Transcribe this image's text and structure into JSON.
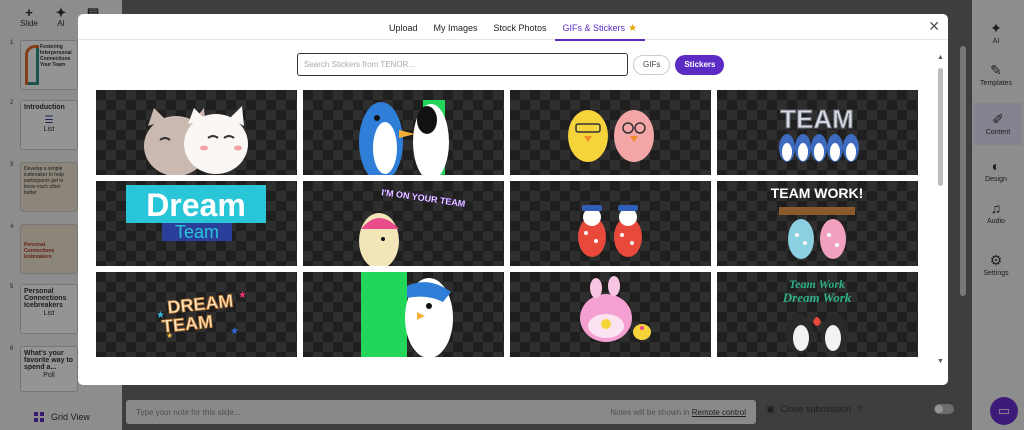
{
  "top_tools": [
    {
      "icon": "plus-icon",
      "label": "Slide"
    },
    {
      "icon": "sparkle-icon",
      "label": "AI"
    }
  ],
  "slides": [
    {
      "num": "1",
      "title": "Fostering Interpersonal Connections Your Team",
      "style": "stripes"
    },
    {
      "num": "2",
      "title": "Introduction",
      "sub": "List"
    },
    {
      "num": "3",
      "title": "Develop a simple icebreaker to help participants get to know each other better",
      "style": "tan"
    },
    {
      "num": "4",
      "title": "Personal Connections Icebreakers",
      "style": "tan"
    },
    {
      "num": "5",
      "title": "Personal Connections Icebreakers",
      "sub": "List"
    },
    {
      "num": "6",
      "title": "What's your favorite way to spend a...",
      "sub": "Poll"
    }
  ],
  "grid_view_label": "Grid View",
  "right_rail": [
    {
      "icon": "sparkle-icon",
      "label": "AI"
    },
    {
      "icon": "templates-icon",
      "label": "Templates"
    },
    {
      "icon": "pencil-icon",
      "label": "Content",
      "active": true
    },
    {
      "icon": "palette-icon",
      "label": "Design"
    },
    {
      "icon": "music-icon",
      "label": "Audio"
    },
    {
      "icon": "gear-icon",
      "label": "Settings"
    }
  ],
  "note_bar": {
    "placeholder": "Type your note for this slide...",
    "hint": "Notes will be shown in",
    "link": "Remote control"
  },
  "close_submission": "Close submission",
  "modal": {
    "tabs": [
      {
        "label": "Upload"
      },
      {
        "label": "My Images"
      },
      {
        "label": "Stock Photos"
      },
      {
        "label": "GIFs & Stickers",
        "active": true
      }
    ],
    "search_placeholder": "Search Stickers from TENOR...",
    "search_value": "",
    "filter_gifs": "GIFs",
    "filter_stickers": "Stickers",
    "stickers": [
      {
        "name": "hugging-cats-sticker",
        "text": ""
      },
      {
        "name": "penguins-high-five-sticker",
        "text": ""
      },
      {
        "name": "chicks-sticker",
        "text": ""
      },
      {
        "name": "team-penguins-sticker",
        "text": "TEAM"
      },
      {
        "name": "dream-team-sticker",
        "text": "Dream",
        "text2": "Team"
      },
      {
        "name": "im-on-your-team-sticker",
        "text": "I'M ON YOUR TEAM"
      },
      {
        "name": "penguins-caps-sticker",
        "text": ""
      },
      {
        "name": "team-work-sticker",
        "text": "TEAM WORK!"
      },
      {
        "name": "dream-team-stars-sticker",
        "text": "DREAM",
        "text2": "TEAM"
      },
      {
        "name": "penguins-hug-sticker",
        "text": ""
      },
      {
        "name": "bunny-chick-sticker",
        "text": ""
      },
      {
        "name": "team-work-dream-work-sticker",
        "text": "Team Work",
        "text2": "Dream Work"
      }
    ]
  }
}
